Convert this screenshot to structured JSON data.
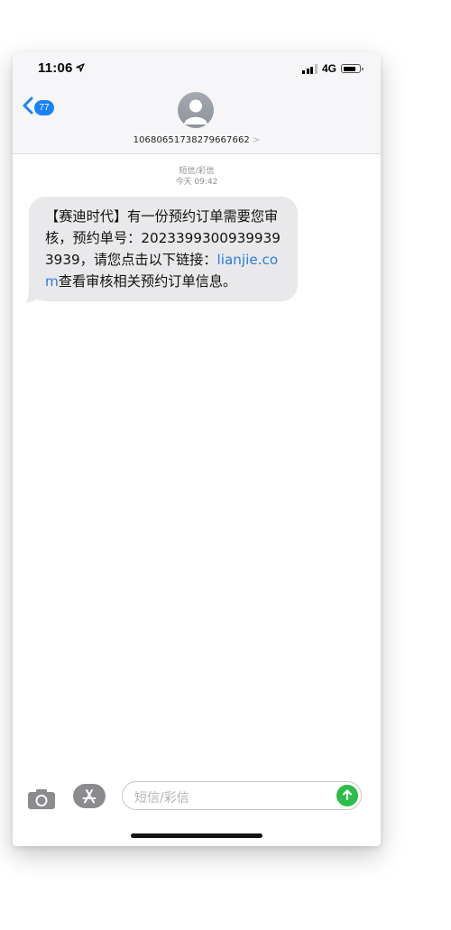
{
  "status_bar": {
    "time": "11:06",
    "network": "4G"
  },
  "header": {
    "back_badge": "77",
    "sender": "10680651738279667662",
    "sender_chevron": ">"
  },
  "thread": {
    "channel_label": "短信/彩信",
    "time_label": "今天 09:42"
  },
  "message": {
    "text_before_link": "【赛迪时代】有一份预约订单需要您审核，预约单号：20233993009399393939，请您点击以下链接：",
    "link": "lianjie.com",
    "text_after_link": "查看审核相关预约订单信息。"
  },
  "compose": {
    "placeholder": "短信/彩信"
  },
  "colors": {
    "accent_blue": "#1a82fb",
    "bubble_gray": "#e9e9eb",
    "send_green": "#2bbd47",
    "link_blue": "#2b7be0"
  },
  "icons": [
    "location-arrow-icon",
    "signal-bars-icon",
    "battery-icon",
    "back-chevron-icon",
    "contact-avatar-icon",
    "camera-icon",
    "app-store-icon",
    "send-arrow-icon"
  ]
}
